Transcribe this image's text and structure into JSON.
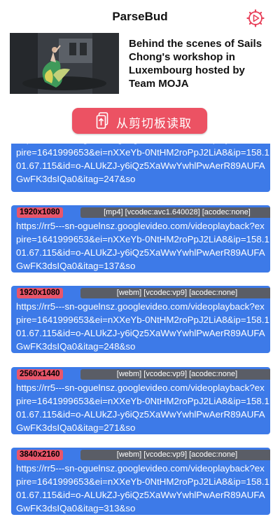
{
  "app": {
    "title": "ParseBud"
  },
  "icons": {
    "settings": "gear-icon",
    "clipboard": "clipboard-arrow-icon"
  },
  "colors": {
    "accent": "#ec5263",
    "card": "#3d7ae8",
    "resolution_badge": "#e8556a",
    "info_badge": "#5a5d66"
  },
  "video": {
    "title": "Behind the scenes of Sails Chong's workshop in Luxembourg hosted by Team MOJA"
  },
  "read_button": {
    "label": "从剪切板读取"
  },
  "formats": [
    {
      "resolution": "",
      "info": "",
      "url": "https://rr5---sn-oguelnsz.googlevideo.com/videoplayback?expire=1641999653&ei=nXXeYb-0NtHM2roPpJ2LiA8&ip=158.101.67.115&id=o-ALUkZJ-y6iQz5XaWwYwhlPwAerR89AUFAGwFK3dsIQa0&itag=247&so"
    },
    {
      "resolution": "1920x1080",
      "info": "[mp4] [vcodec:avc1.640028] [acodec:none]",
      "url": "https://rr5---sn-oguelnsz.googlevideo.com/videoplayback?expire=1641999653&ei=nXXeYb-0NtHM2roPpJ2LiA8&ip=158.101.67.115&id=o-ALUkZJ-y6iQz5XaWwYwhlPwAerR89AUFAGwFK3dsIQa0&itag=137&so"
    },
    {
      "resolution": "1920x1080",
      "info": "[webm] [vcodec:vp9] [acodec:none]",
      "url": "https://rr5---sn-oguelnsz.googlevideo.com/videoplayback?expire=1641999653&ei=nXXeYb-0NtHM2roPpJ2LiA8&ip=158.101.67.115&id=o-ALUkZJ-y6iQz5XaWwYwhlPwAerR89AUFAGwFK3dsIQa0&itag=248&so"
    },
    {
      "resolution": "2560x1440",
      "info": "[webm] [vcodec:vp9] [acodec:none]",
      "url": "https://rr5---sn-oguelnsz.googlevideo.com/videoplayback?expire=1641999653&ei=nXXeYb-0NtHM2roPpJ2LiA8&ip=158.101.67.115&id=o-ALUkZJ-y6iQz5XaWwYwhlPwAerR89AUFAGwFK3dsIQa0&itag=271&so"
    },
    {
      "resolution": "3840x2160",
      "info": "[webm] [vcodec:vp9] [acodec:none]",
      "url": "https://rr5---sn-oguelnsz.googlevideo.com/videoplayback?expire=1641999653&ei=nXXeYb-0NtHM2roPpJ2LiA8&ip=158.101.67.115&id=o-ALUkZJ-y6iQz5XaWwYwhlPwAerR89AUFAGwFK3dsIQa0&itag=313&so"
    }
  ]
}
